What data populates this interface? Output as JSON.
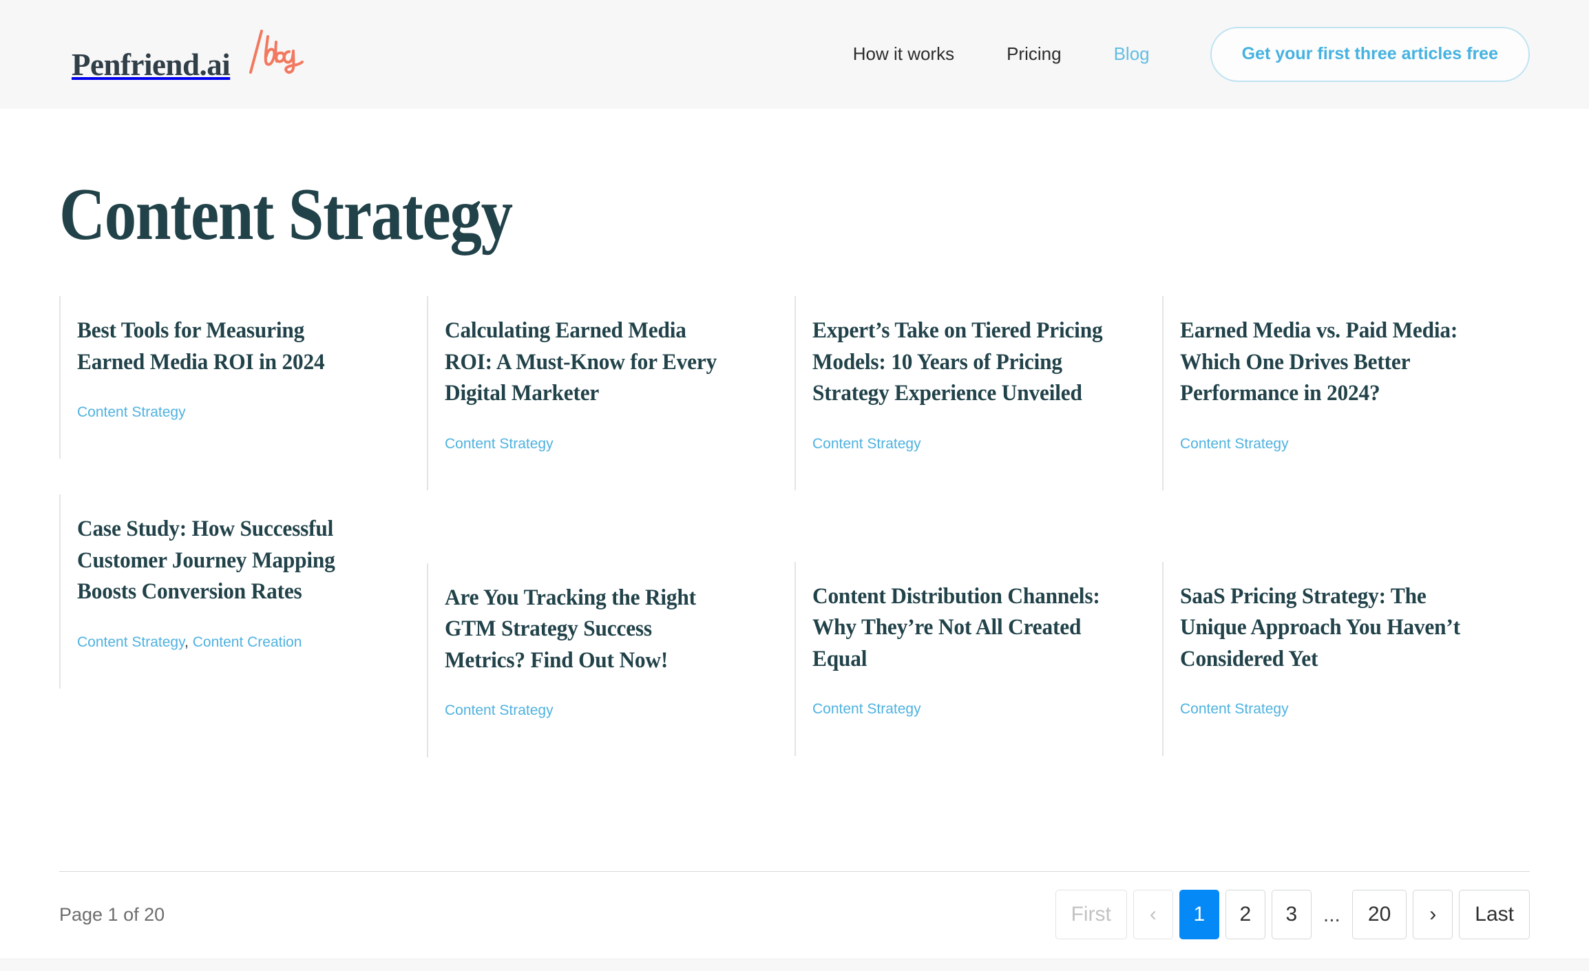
{
  "header": {
    "logo": {
      "brand_text": "Penfriend.ai",
      "blog_text": "/blog",
      "brand_color": "#303e48",
      "blog_color": "#f2785f"
    },
    "nav": [
      {
        "label": "How it works",
        "active": false
      },
      {
        "label": "Pricing",
        "active": false
      },
      {
        "label": "Blog",
        "active": true
      }
    ],
    "cta": {
      "label": "Get your first three articles free",
      "color": "#45b2e0",
      "border_color": "#bfe3f2"
    }
  },
  "main": {
    "page_title": "Content Strategy",
    "title_color": "#214249",
    "tag_color": "#4fb2e0",
    "columns": [
      {
        "cards": [
          {
            "title": "Best Tools for Measuring Earned Media ROI in 2024",
            "tags": "Content Strategy"
          },
          {
            "title": "Case Study: How Successful Customer Journey Mapping Boosts Conversion Rates",
            "tags_primary": "Content Strategy",
            "tags_separator": ",",
            "tags_secondary": " Content Creation"
          }
        ]
      },
      {
        "cards": [
          {
            "title": "Calculating Earned Media ROI: A Must-Know for Every Digital Marketer",
            "tags": "Content Strategy"
          },
          {
            "title": "Are You Tracking the Right GTM Strategy Success Metrics? Find Out Now!",
            "tags": "Content Strategy"
          }
        ]
      },
      {
        "cards": [
          {
            "title": "Expert’s Take on Tiered Pricing Models: 10 Years of Pricing Strategy Experience Unveiled",
            "tags": "Content Strategy"
          },
          {
            "title": "Content Distribution Channels: Why They’re Not All Created Equal",
            "tags": "Content Strategy"
          }
        ]
      },
      {
        "cards": [
          {
            "title": "Earned Media vs. Paid Media: Which One Drives Better Performance in 2024?",
            "tags": "Content Strategy"
          },
          {
            "title": "SaaS Pricing Strategy: The Unique Approach You Haven’t Considered Yet",
            "tags": "Content Strategy"
          }
        ]
      }
    ]
  },
  "pagination": {
    "status": "Page 1 of 20",
    "current_page": "1",
    "total_pages": "20",
    "active_color": "#0489f7",
    "buttons": {
      "first": "First",
      "prev": "‹",
      "page1": "1",
      "page2": "2",
      "page3": "3",
      "ellipsis": "...",
      "page_last_number": "20",
      "next": "›",
      "last": "Last"
    }
  }
}
